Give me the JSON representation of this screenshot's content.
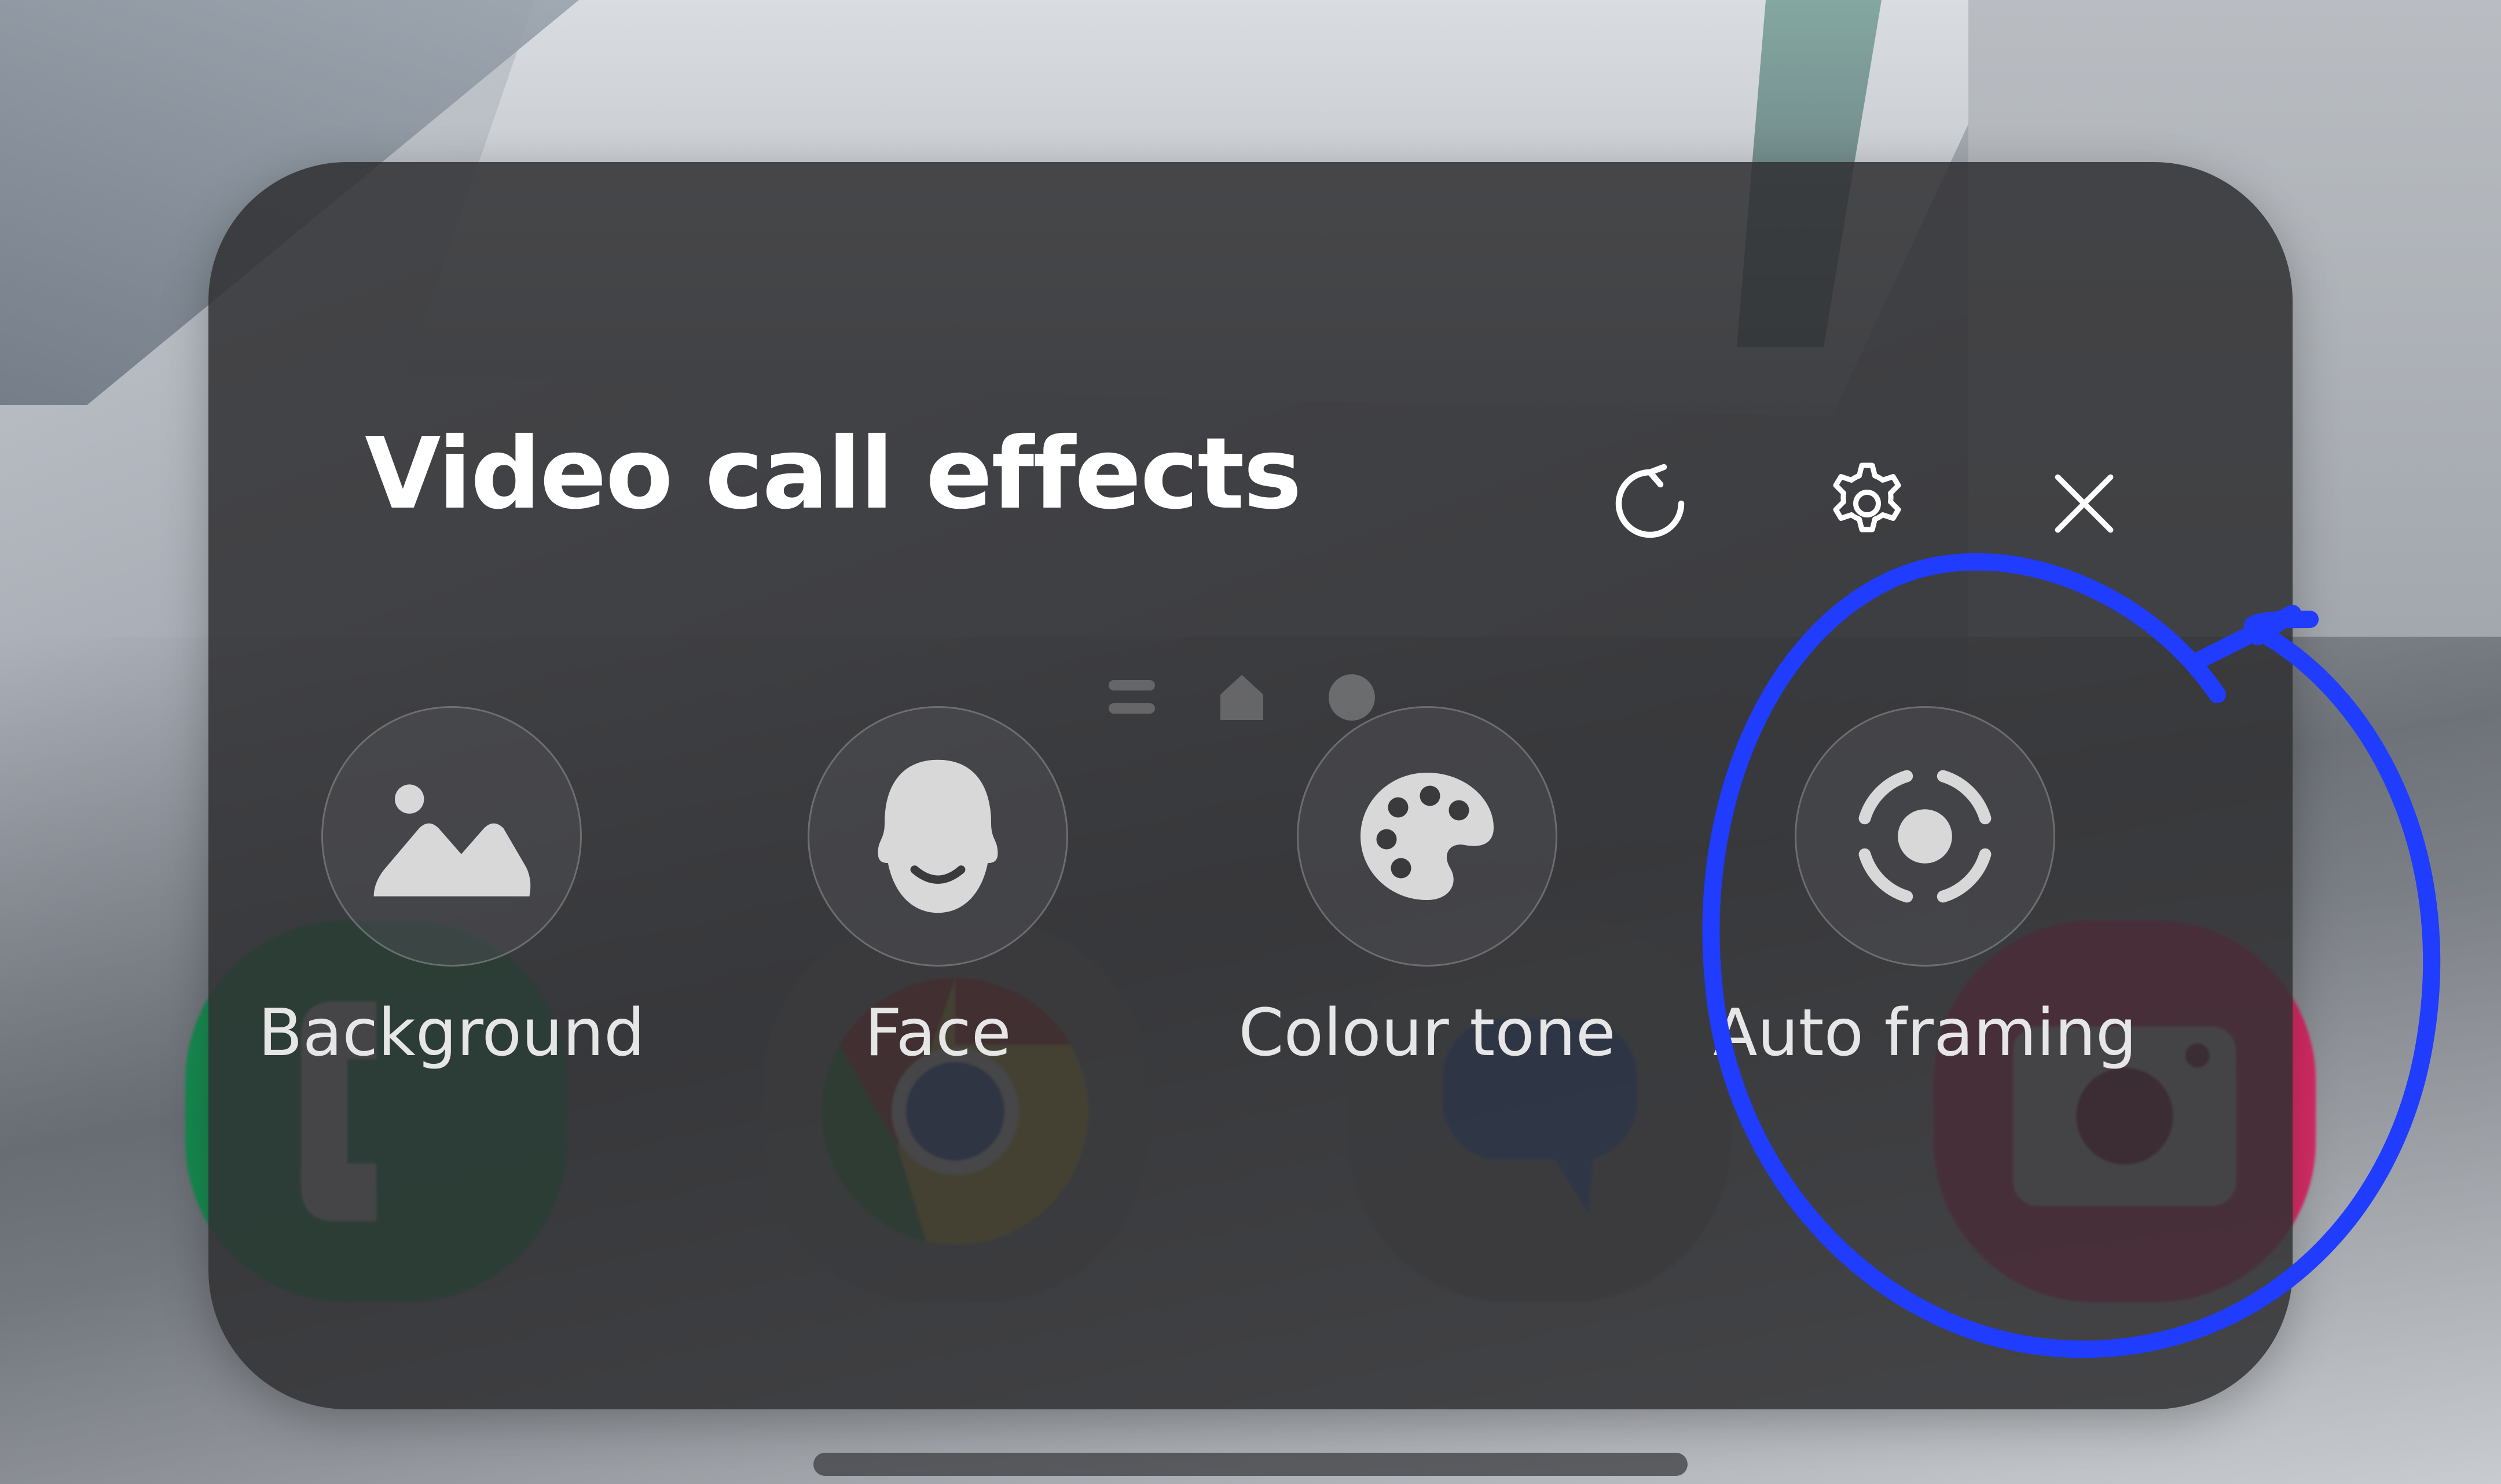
{
  "panel": {
    "title": "Video call effects"
  },
  "header_buttons": {
    "reset_icon": "reset-icon",
    "settings_icon": "gear-icon",
    "close_icon": "close-icon"
  },
  "effects": [
    {
      "label": "Background",
      "icon": "landscape-image-icon"
    },
    {
      "label": "Face",
      "icon": "face-icon"
    },
    {
      "label": "Colour tone",
      "icon": "palette-icon"
    },
    {
      "label": "Auto framing",
      "icon": "auto-framing-icon"
    }
  ],
  "dock_apps": [
    {
      "icon": "phone-icon",
      "color": "#0a8f4a"
    },
    {
      "icon": "chrome-icon",
      "color": "#4285f4"
    },
    {
      "icon": "messages-icon",
      "color": "#1a56c8"
    },
    {
      "icon": "camera-icon",
      "color": "#e0195a"
    }
  ],
  "colors": {
    "panel_bg": "#303032",
    "annotation": "#1f3cff",
    "text": "#ffffff"
  }
}
